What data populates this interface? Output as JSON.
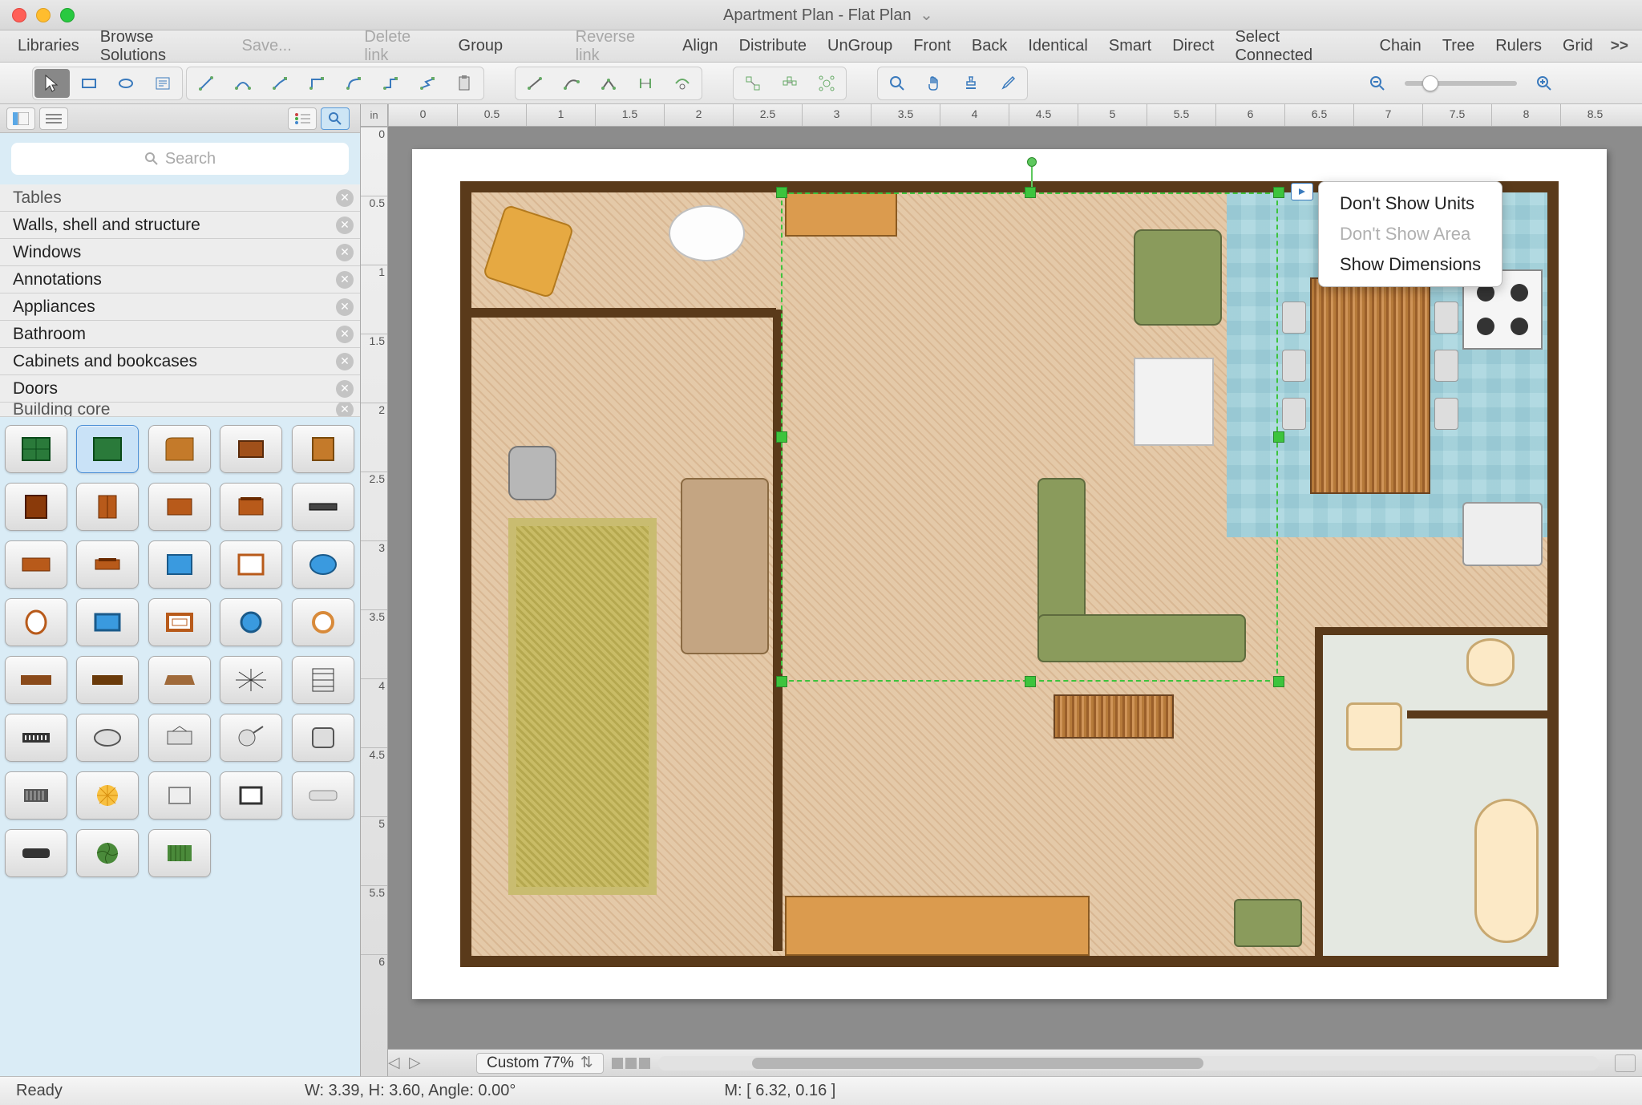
{
  "title": "Apartment Plan - Flat Plan",
  "menu": {
    "libraries": "Libraries",
    "browse": "Browse Solutions",
    "save": "Save...",
    "delete_link": "Delete link",
    "group": "Group",
    "reverse_link": "Reverse link",
    "align": "Align",
    "distribute": "Distribute",
    "ungroup": "UnGroup",
    "front": "Front",
    "back": "Back",
    "identical": "Identical",
    "smart": "Smart",
    "direct": "Direct",
    "select_connected": "Select Connected",
    "chain": "Chain",
    "tree": "Tree",
    "rulers": "Rulers",
    "grid": "Grid",
    "overflow": ">>"
  },
  "search": {
    "placeholder": "Search"
  },
  "categories": [
    "Tables",
    "Walls, shell and structure",
    "Windows",
    "Annotations",
    "Appliances",
    "Bathroom",
    "Cabinets and bookcases",
    "Doors",
    "Building core"
  ],
  "ruler_unit": "in",
  "ruler_h": [
    "0",
    "0.5",
    "1",
    "1.5",
    "2",
    "2.5",
    "3",
    "3.5",
    "4",
    "4.5",
    "5",
    "5.5",
    "6",
    "6.5",
    "7",
    "7.5",
    "8",
    "8.5"
  ],
  "ruler_v": [
    "0",
    "0.5",
    "1",
    "1.5",
    "2",
    "2.5",
    "3",
    "3.5",
    "4",
    "4.5",
    "5",
    "5.5",
    "6"
  ],
  "popup": {
    "no_units": "Don't Show Units",
    "no_area": "Don't Show Area",
    "show_dim": "Show Dimensions"
  },
  "zoom_label": "Custom 77%",
  "status": {
    "ready": "Ready",
    "dims": "W: 3.39,  H: 3.60,  Angle: 0.00°",
    "mouse": "M: [ 6.32, 0.16 ]"
  },
  "shapes_count": 40
}
